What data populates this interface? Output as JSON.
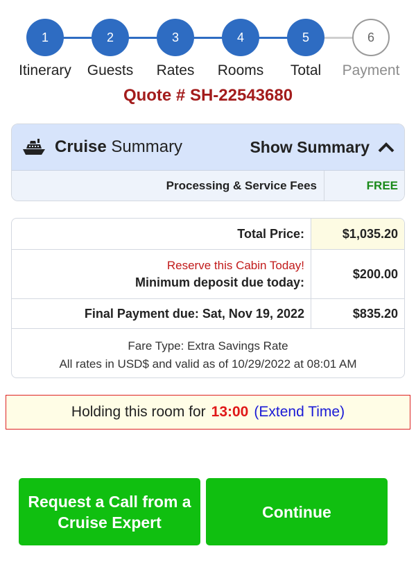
{
  "stepper": {
    "steps": [
      {
        "number": "1",
        "label": "Itinerary",
        "state": "complete"
      },
      {
        "number": "2",
        "label": "Guests",
        "state": "complete"
      },
      {
        "number": "3",
        "label": "Rates",
        "state": "complete"
      },
      {
        "number": "4",
        "label": "Rooms",
        "state": "complete"
      },
      {
        "number": "5",
        "label": "Total",
        "state": "complete"
      },
      {
        "number": "6",
        "label": "Payment",
        "state": "pending"
      }
    ]
  },
  "quote": {
    "text": "Quote # SH-22543680"
  },
  "summary": {
    "title_bold": "Cruise",
    "title_rest": "Summary",
    "icon": "cruise-ship-icon",
    "toggle_label": "Show Summary",
    "toggle_icon": "chevron-up-icon",
    "fees_label": "Processing & Service Fees",
    "fees_value": "FREE"
  },
  "pricing": {
    "total_label": "Total Price:",
    "total_value": "$1,035.20",
    "reserve_note": "Reserve this Cabin Today!",
    "deposit_label": "Minimum deposit due today:",
    "deposit_value": "$200.00",
    "final_label": "Final Payment due: Sat, Nov 19, 2022",
    "final_value": "$835.20",
    "fare_type": "Fare Type: Extra Savings Rate",
    "rates_note": "All rates in USD$ and valid as of 10/29/2022 at 08:01 AM"
  },
  "hold": {
    "text": "Holding this room for",
    "timer": "13:00",
    "extend_label": "(Extend Time)"
  },
  "buttons": {
    "call_label": "Request a Call from a Cruise Expert",
    "continue_label": "Continue"
  },
  "colors": {
    "step_active": "#2e6cc2",
    "accent_red": "#a31c1c",
    "free_green": "#1a8a1a",
    "button_green": "#10bf10"
  }
}
